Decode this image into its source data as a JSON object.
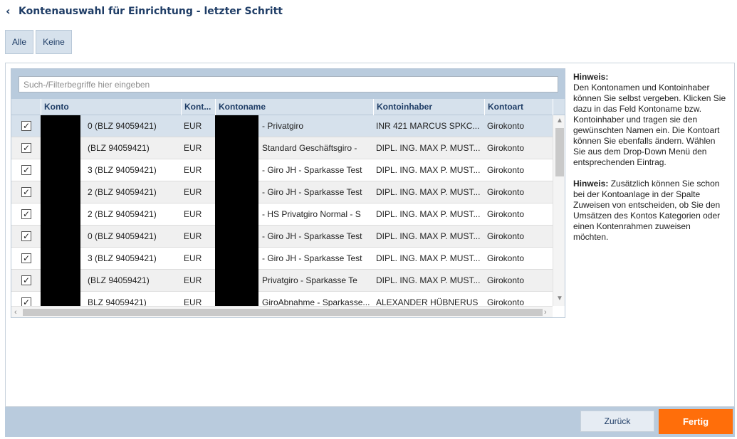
{
  "header": {
    "back_icon": "‹",
    "title": "Kontenauswahl für Einrichtung - letzter Schritt"
  },
  "selection": {
    "all_label": "Alle",
    "none_label": "Keine"
  },
  "filter": {
    "placeholder": "Such-/Filterbegriffe hier eingeben",
    "value": ""
  },
  "table": {
    "columns": [
      "Konto",
      "Kont...",
      "Kontoname",
      "Kontoinhaber",
      "Kontoart"
    ],
    "rows": [
      {
        "checked": true,
        "konto": "0 (BLZ 94059421)",
        "waehrung": "EUR",
        "kontoname": "- Privatgiro",
        "inhaber": "INR 421 MARCUS SPKC...",
        "art": "Girokonto"
      },
      {
        "checked": true,
        "konto": "(BLZ 94059421)",
        "waehrung": "EUR",
        "kontoname": "Standard Geschäftsgiro -",
        "inhaber": "DIPL. ING. MAX P. MUST...",
        "art": "Girokonto"
      },
      {
        "checked": true,
        "konto": "3 (BLZ 94059421)",
        "waehrung": "EUR",
        "kontoname": "- Giro JH - Sparkasse Test",
        "inhaber": "DIPL. ING. MAX P. MUST...",
        "art": "Girokonto"
      },
      {
        "checked": true,
        "konto": "2 (BLZ 94059421)",
        "waehrung": "EUR",
        "kontoname": "- Giro JH - Sparkasse Test",
        "inhaber": "DIPL. ING. MAX P. MUST...",
        "art": "Girokonto"
      },
      {
        "checked": true,
        "konto": "2 (BLZ 94059421)",
        "waehrung": "EUR",
        "kontoname": "- HS Privatgiro Normal - S",
        "inhaber": "DIPL. ING. MAX P. MUST...",
        "art": "Girokonto"
      },
      {
        "checked": true,
        "konto": "0 (BLZ 94059421)",
        "waehrung": "EUR",
        "kontoname": "- Giro JH - Sparkasse Test",
        "inhaber": "DIPL. ING. MAX P. MUST...",
        "art": "Girokonto"
      },
      {
        "checked": true,
        "konto": "3 (BLZ 94059421)",
        "waehrung": "EUR",
        "kontoname": "- Giro JH - Sparkasse Test",
        "inhaber": "DIPL. ING. MAX P. MUST...",
        "art": "Girokonto"
      },
      {
        "checked": true,
        "konto": "(BLZ 94059421)",
        "waehrung": "EUR",
        "kontoname": "Privatgiro - Sparkasse Te",
        "inhaber": "DIPL. ING. MAX P. MUST...",
        "art": "Girokonto"
      },
      {
        "checked": true,
        "konto": "BLZ 94059421)",
        "waehrung": "EUR",
        "kontoname": "GiroAbnahme - Sparkasse...",
        "inhaber": "ALEXANDER HÜBNERUS",
        "art": "Girokonto"
      }
    ]
  },
  "hints": [
    {
      "label": "Hinweis:",
      "text": "Den Kontonamen und Kontoinhaber können Sie selbst vergeben. Klicken Sie dazu in das Feld Kontoname bzw. Kontoinhaber und tragen sie den gewünschten Namen ein. Die Kontoart können Sie ebenfalls ändern. Wählen Sie aus dem Drop-Down Menü den entsprechenden Eintrag."
    },
    {
      "label": "Hinweis:",
      "text": "Zusätzlich können Sie schon bei der Kontoanlage in der Spalte Zuweisen von entscheiden, ob Sie den Umsätzen des Kontos Kategorien oder einen Kontenrahmen zuweisen möchten."
    }
  ],
  "footer": {
    "back_label": "Zurück",
    "done_label": "Fertig"
  },
  "icons": {
    "checkbox": "check-icon",
    "scroll_up": "▲",
    "scroll_down": "▼",
    "scroll_left": "‹",
    "scroll_right": "›"
  },
  "colors": {
    "accent": "#ff6e0a",
    "header_blue": "#1f3d66",
    "bar": "#b9cbdd"
  }
}
